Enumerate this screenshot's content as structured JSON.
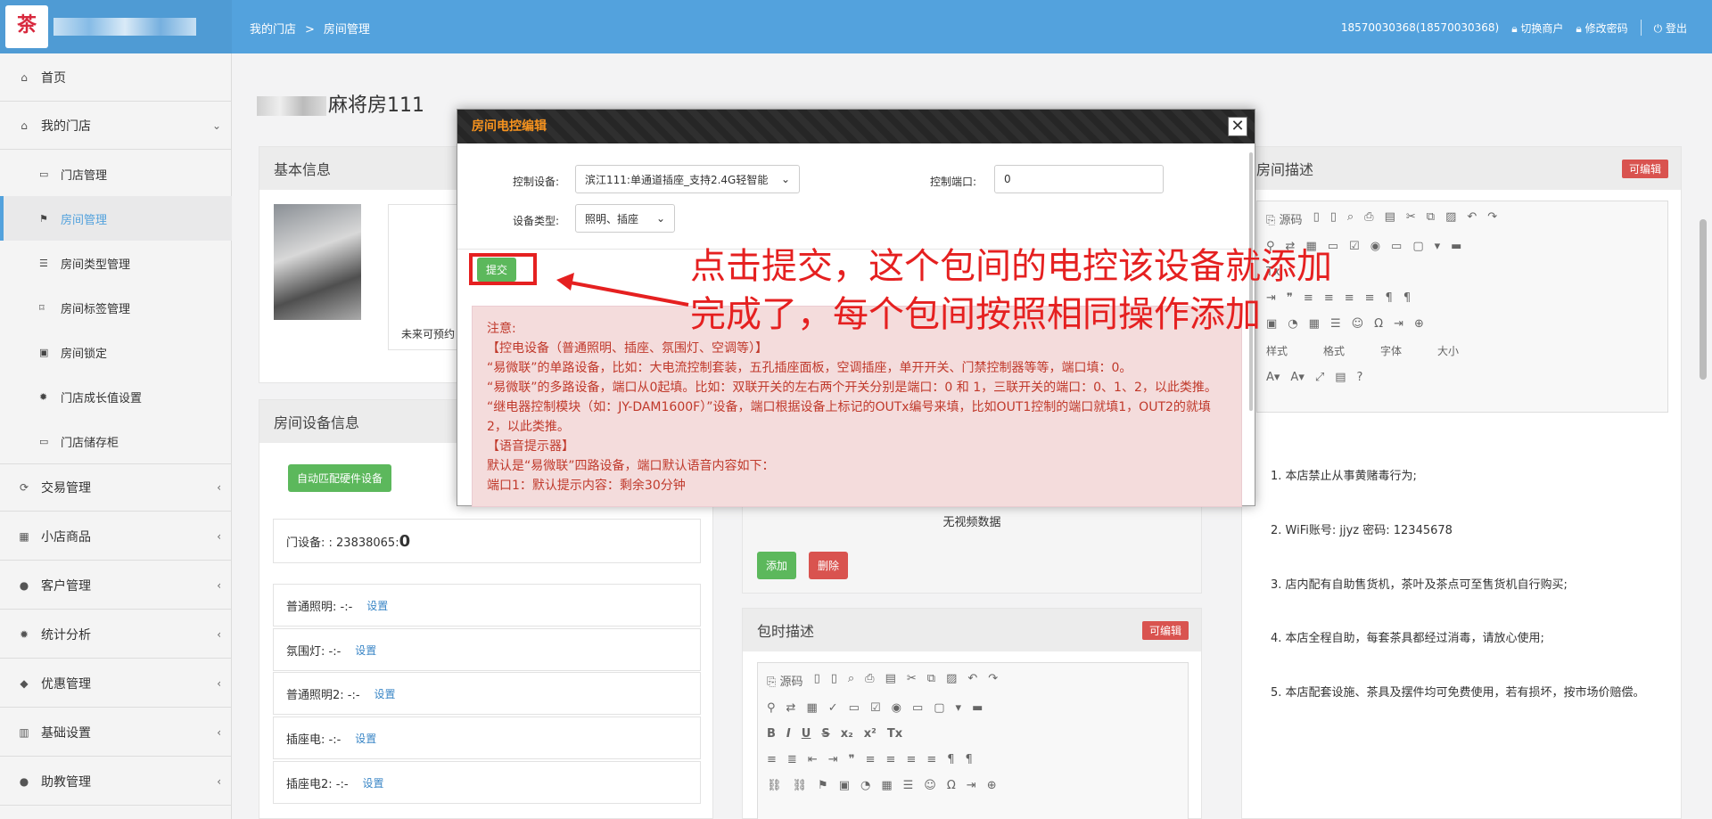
{
  "header": {
    "breadcrumb": [
      "我的门店",
      ">",
      "房间管理"
    ],
    "account": "18570030368(18570030368)",
    "switch_merchant": "切换商户",
    "change_password": "修改密码",
    "logout": "登出"
  },
  "sidebar": {
    "items": [
      {
        "label": "首页",
        "icon": "home-icon"
      },
      {
        "label": "我的门店",
        "icon": "store-icon"
      },
      {
        "label": "门店管理",
        "icon": "monitor-icon"
      },
      {
        "label": "房间管理",
        "icon": "flag-icon"
      },
      {
        "label": "房间类型管理",
        "icon": "list-icon"
      },
      {
        "label": "房间标签管理",
        "icon": "bookmark-icon"
      },
      {
        "label": "房间锁定",
        "icon": "lock-icon"
      },
      {
        "label": "门店成长值设置",
        "icon": "gear-icon"
      },
      {
        "label": "门店储存柜",
        "icon": "monitor-icon"
      },
      {
        "label": "交易管理",
        "icon": "refresh-icon"
      },
      {
        "label": "小店商品",
        "icon": "gift-icon"
      },
      {
        "label": "客户管理",
        "icon": "user-icon"
      },
      {
        "label": "统计分析",
        "icon": "gear-icon"
      },
      {
        "label": "优惠管理",
        "icon": "tag-icon"
      },
      {
        "label": "基础设置",
        "icon": "barcode-icon"
      },
      {
        "label": "助教管理",
        "icon": "user-icon"
      }
    ]
  },
  "page": {
    "title": "麻将房111",
    "basic_info": "基本信息",
    "room_desc": "房间描述",
    "editable": "可编辑",
    "unavailable": "未来可预约",
    "device_info": "房间设备信息",
    "auto_match": "自动匹配硬件设备",
    "door_device": "门设备: : 23838065:",
    "door_value": "0",
    "devices": [
      {
        "label": "普通照明: -:-",
        "action": "设置"
      },
      {
        "label": "氛围灯: -:-",
        "action": "设置"
      },
      {
        "label": "普通照明2: -:-",
        "action": "设置"
      },
      {
        "label": "插座电: -:-",
        "action": "设置"
      },
      {
        "label": "插座电2: -:-",
        "action": "设置"
      }
    ],
    "no_video": "无视频数据",
    "add": "添加",
    "delete": "删除",
    "package_desc": "包时描述",
    "source": "源码",
    "style": "样式",
    "format": "格式",
    "font": "字体",
    "size": "大小"
  },
  "rules": [
    "1. 本店禁止从事黄赌毒行为;",
    "2. WiFi账号: jjyz 密码: 12345678",
    "3. 店内配有自助售货机，茶叶及茶点可至售货机自行购买;",
    "4. 本店全程自助，每套茶具都经过消毒，请放心使用;",
    "5. 本店配套设施、茶具及摆件均可免费使用，若有损坏，按市场价赔偿。"
  ],
  "modal": {
    "title": "房间电控编辑",
    "control_device_label": "控制设备:",
    "control_device_value": "滨江111:单通道插座_支持2.4G轻智能",
    "control_port_label": "控制端口:",
    "control_port_value": "0",
    "device_type_label": "设备类型:",
    "device_type_value": "照明、插座",
    "submit": "提交",
    "notice": [
      "注意:",
      "【控电设备（普通照明、插座、氛围灯、空调等）】",
      "“易微联”的单路设备，比如：大电流控制套装，五孔插座面板，空调插座，单开开关、门禁控制器等等，端口填：0。",
      "“易微联”的多路设备，端口从0起填。比如：双联开关的左右两个开关分别是端口：0 和 1，三联开关的端口：0、1、2，以此类推。",
      "“继电器控制模块（如：JY-DAM1600F）”设备，端口根据设备上标记的OUTx编号来填，比如OUT1控制的端口就填1，OUT2的就填2，以此类推。",
      "【语音提示器】",
      "默认是“易微联”四路设备，端口默认语音内容如下：",
      "端口1：默认提示内容：剩余30分钟"
    ]
  },
  "annotation": [
    "点击提交，这个包间的电控该设备就添加",
    "完成了，每个包间按照相同操作添加"
  ],
  "colors": {
    "topbar": "#53a2dd",
    "annotation": "#e52020",
    "submit": "#5cb85c",
    "modal_title": "#f7931e"
  }
}
